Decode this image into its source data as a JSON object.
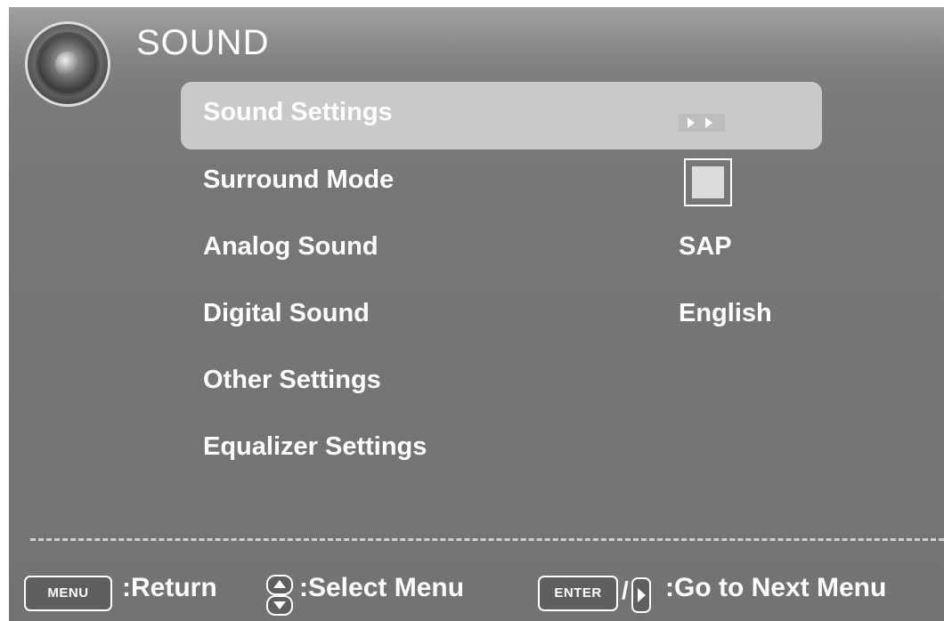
{
  "header": {
    "title": "SOUND",
    "icon": "speaker-icon"
  },
  "menu": {
    "items": [
      {
        "label": "Sound  Settings",
        "value_type": "submenu-arrows",
        "selected": true
      },
      {
        "label": "Surround Mode",
        "value_type": "checkbox",
        "checked": false
      },
      {
        "label": "Analog Sound",
        "value": "SAP"
      },
      {
        "label": "Digital Sound",
        "value": "English"
      },
      {
        "label": "Other Settings"
      },
      {
        "label": "Equalizer Settings"
      }
    ]
  },
  "footer": {
    "menu_key": "MENU",
    "return_label": ":Return",
    "select_label": ":Select Menu",
    "enter_key": "ENTER",
    "slash": "/",
    "next_label": ":Go to Next Menu"
  },
  "colors": {
    "background": "#767676",
    "highlight": "#c9c9c9",
    "text": "#ffffff"
  }
}
